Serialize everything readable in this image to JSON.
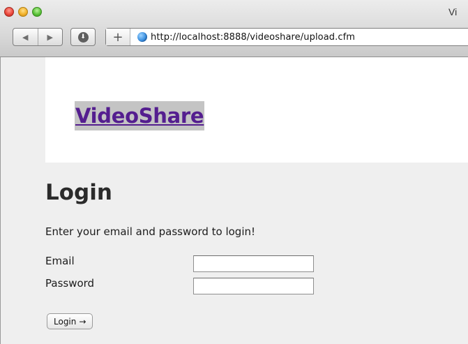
{
  "window": {
    "title": "Vi"
  },
  "toolbar": {
    "back_glyph": "◀",
    "forward_glyph": "▶",
    "download_glyph": "⬇",
    "add_glyph": "+"
  },
  "address_bar": {
    "url": "http://localhost:8888/videoshare/upload.cfm"
  },
  "site": {
    "logo_text": "VideoShare"
  },
  "login": {
    "heading": "Login",
    "intro": "Enter your email and password to login!",
    "email_label": "Email",
    "email_value": "",
    "password_label": "Password",
    "password_value": "",
    "button_label": "Login",
    "button_arrow": "→"
  },
  "colors": {
    "link_purple": "#541e8f",
    "page_background": "#efefef"
  }
}
